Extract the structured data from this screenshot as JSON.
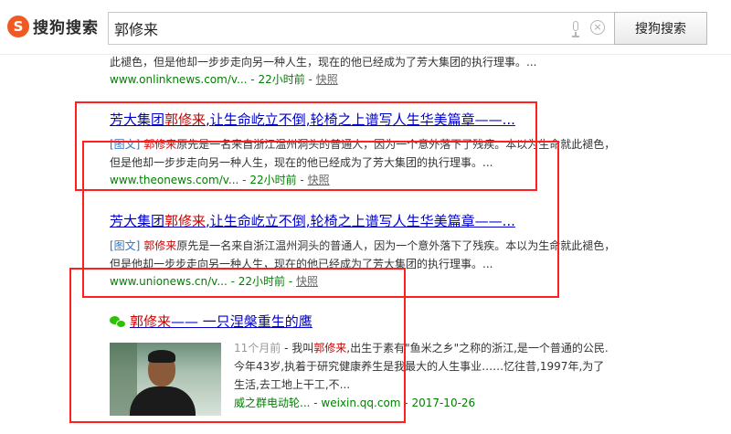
{
  "header": {
    "logo_mark": "S",
    "logo_text": "搜狗搜索",
    "search_value": "郭修来",
    "search_button": "搜狗搜索",
    "clear_glyph": "×"
  },
  "results": [
    {
      "abstract": "此褪色，但是他却一步步走向另一种人生，现在的他已经成为了芳大集团的执行理事。...",
      "meta_url": "www.onlinknews.com/v...",
      "meta_time": " - 22小时前 - ",
      "snapshot": "快照"
    },
    {
      "title_pre": "芳大集团",
      "title_hl": "郭修来",
      "title_post": ",让生命屹立不倒,轮椅之上谱写人生华美篇章——...",
      "tag": "[图文]",
      "abstract_hl": " 郭修来",
      "abstract_rest": "原先是一名来自浙江温州洞头的普通人，因为一个意外落下了残疾。本以为生命就此褪色，但是他却一步步走向另一种人生，现在的他已经成为了芳大集团的执行理事。...",
      "meta_url": "www.theonews.com/v...",
      "meta_time": " - 22小时前 - ",
      "snapshot": "快照"
    },
    {
      "title_pre": "芳大集团",
      "title_hl": "郭修来",
      "title_post": ",让生命屹立不倒,轮椅之上谱写人生华美篇章——...",
      "tag": "[图文]",
      "abstract_hl": " 郭修来",
      "abstract_rest": "原先是一名来自浙江温州洞头的普通人，因为一个意外落下了残疾。本以为生命就此褪色，但是他却一步步走向另一种人生，现在的他已经成为了芳大集团的执行理事。...",
      "meta_url": "www.unionews.cn/v...",
      "meta_time": " - 22小时前 - ",
      "snapshot": "快照"
    }
  ],
  "wechat": {
    "title_hl": "郭修来",
    "title_post": "—— 一只涅槃重生的鹰",
    "time_ago": "11个月前",
    "abstract_pre": " - 我叫",
    "abstract_hl": "郭修来",
    "abstract_rest": ",出生于素有\"鱼米之乡\"之称的浙江,是一个普通的公民.今年43岁,执着于研究健康养生是我最大的人生事业……忆往昔,1997年,为了生活,去工地上干工,不...",
    "account": "威之群电动轮...",
    "domain": " - weixin.qq.com - ",
    "date": "2017-10-26"
  },
  "colors": {
    "link": "#0000cc",
    "highlight": "#cc0000",
    "url_green": "#008000",
    "annotation_red": "#ff1f1f",
    "logo_orange": "#f05a22"
  }
}
